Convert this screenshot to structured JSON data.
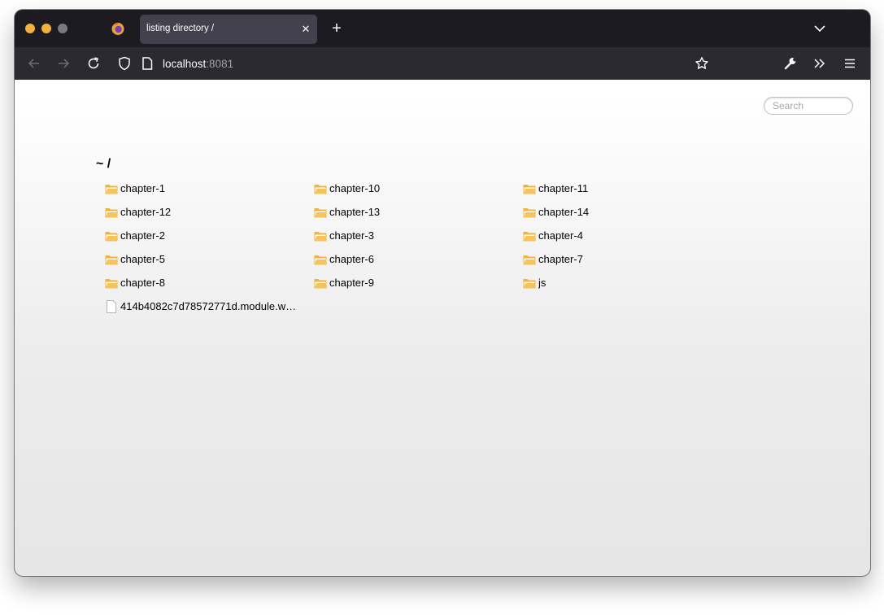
{
  "browser": {
    "tab": {
      "title": "listing directory /"
    },
    "url": {
      "host": "localhost",
      "port": ":8081"
    }
  },
  "page": {
    "search": {
      "placeholder": "Search"
    },
    "breadcrumb": {
      "home": "~",
      "separator": "/"
    },
    "files": [
      {
        "name": "chapter-1",
        "type": "folder"
      },
      {
        "name": "chapter-10",
        "type": "folder"
      },
      {
        "name": "chapter-11",
        "type": "folder"
      },
      {
        "name": "chapter-12",
        "type": "folder"
      },
      {
        "name": "chapter-13",
        "type": "folder"
      },
      {
        "name": "chapter-14",
        "type": "folder"
      },
      {
        "name": "chapter-2",
        "type": "folder"
      },
      {
        "name": "chapter-3",
        "type": "folder"
      },
      {
        "name": "chapter-4",
        "type": "folder"
      },
      {
        "name": "chapter-5",
        "type": "folder"
      },
      {
        "name": "chapter-6",
        "type": "folder"
      },
      {
        "name": "chapter-7",
        "type": "folder"
      },
      {
        "name": "chapter-8",
        "type": "folder"
      },
      {
        "name": "chapter-9",
        "type": "folder"
      },
      {
        "name": "js",
        "type": "folder"
      },
      {
        "name": "414b4082c7d78572771d.module.w…",
        "type": "file"
      }
    ]
  },
  "colors": {
    "folder": "#f2b33d",
    "traffic_close": "#f0b23c",
    "traffic_min": "#f0b23c",
    "traffic_max": "#7b7a80"
  }
}
